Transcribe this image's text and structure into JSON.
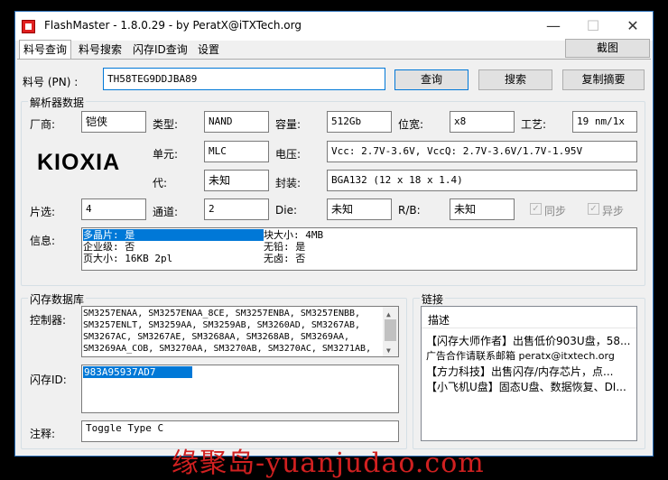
{
  "window": {
    "title": "FlashMaster - 1.8.0.29 - by PeratX@iTXTech.org"
  },
  "tabs": [
    {
      "label": "料号查询"
    },
    {
      "label": "料号搜索"
    },
    {
      "label": "闪存ID查询"
    },
    {
      "label": "设置"
    }
  ],
  "screenshot_label": "截图",
  "part": {
    "label": "料号 (PN) :",
    "value": "TH58TEG9DDJBA89",
    "query_button": "查询",
    "search_button": "搜索",
    "copy_button": "复制摘要"
  },
  "parser": {
    "title": "解析器数据",
    "vendor_label": "厂商:",
    "vendor_value": "铠侠",
    "type_label": "类型:",
    "type_value": "NAND",
    "capacity_label": "容量:",
    "capacity_value": "512Gb",
    "width_label": "位宽:",
    "width_value": "x8",
    "process_label": "工艺:",
    "process_value": "19 nm/1x",
    "logo_text": "KIOXIA",
    "cell_label": "单元:",
    "cell_value": "MLC",
    "voltage_label": "电压:",
    "voltage_value": "Vcc: 2.7V-3.6V, VccQ: 2.7V-3.6V/1.7V-1.95V",
    "gen_label": "代:",
    "gen_value": "未知",
    "package_label": "封装:",
    "package_value": "BGA132 (12 x 18 x 1.4)",
    "ce_label": "片选:",
    "ce_value": "4",
    "channel_label": "通道:",
    "channel_value": "2",
    "die_label": "Die:",
    "die_value": "未知",
    "rb_label": "R/B:",
    "rb_value": "未知",
    "sync_label": "同步",
    "async_label": "异步",
    "info_label": "信息:",
    "info": {
      "multi_die": "多晶片: 是",
      "block_size": "块大小: 4MB",
      "enterprise": "企业级: 否",
      "lead_free": "无铅: 是",
      "page_size": "页大小: 16KB 2pl",
      "halogen_free": "无卤: 否"
    }
  },
  "flashdb": {
    "title": "闪存数据库",
    "controller_label": "控制器:",
    "controllers": [
      "SM3257ENAA, SM3257ENAA_8CE, SM3257ENBA, SM3257ENBB,",
      "SM3257ENLT, SM3259AA, SM3259AB, SM3260AD, SM3267AB,",
      "SM3267AC, SM3267AE, SM3268AA, SM3268AB, SM3269AA,",
      "SM3269AA_COB, SM3270AA, SM3270AB, SM3270AC, SM3271AB,"
    ],
    "flashid_label": "闪存ID:",
    "flashid_value": "983A95937AD7",
    "note_label": "注释:",
    "note_value": "Toggle Type C"
  },
  "links": {
    "title": "链接",
    "header": "描述",
    "items": [
      "【闪存大师作者】出售低价903U盘，58...",
      "广告合作请联系邮箱 peratx@itxtech.org",
      "【方力科技】出售闪存/内存芯片，点...",
      "【小飞机U盘】固态U盘、数据恢复、DI..."
    ]
  },
  "watermark": "缘聚岛-yuanjudao.com"
}
